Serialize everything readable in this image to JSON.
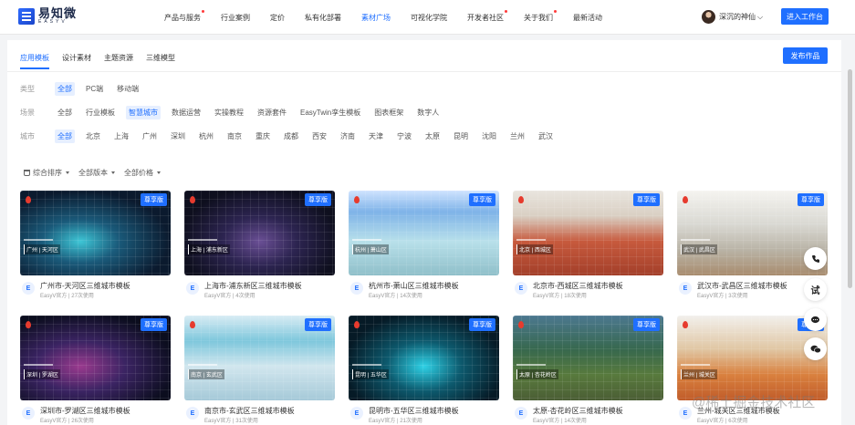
{
  "header": {
    "logo_cn": "易知微",
    "logo_en": "EASYV",
    "nav": [
      {
        "label": "产品与服务",
        "dot": true,
        "active": false
      },
      {
        "label": "行业案例",
        "dot": false,
        "active": false
      },
      {
        "label": "定价",
        "dot": false,
        "active": false
      },
      {
        "label": "私有化部署",
        "dot": false,
        "active": false
      },
      {
        "label": "素材广场",
        "dot": false,
        "active": true
      },
      {
        "label": "可视化学院",
        "dot": false,
        "active": false
      },
      {
        "label": "开发者社区",
        "dot": true,
        "active": false
      },
      {
        "label": "关于我们",
        "dot": true,
        "active": false
      },
      {
        "label": "最新活动",
        "dot": false,
        "active": false
      }
    ],
    "username": "深沉的神仙",
    "workspace_button": "进入工作台"
  },
  "tabs": [
    {
      "label": "应用模板",
      "active": true
    },
    {
      "label": "设计素材",
      "active": false
    },
    {
      "label": "主题资源",
      "active": false
    },
    {
      "label": "三维模型",
      "active": false
    }
  ],
  "publish_button": "发布作品",
  "filters": [
    {
      "label": "类型",
      "options": [
        "全部",
        "PC端",
        "移动端"
      ],
      "active": 0
    },
    {
      "label": "场景",
      "options": [
        "全部",
        "行业模板",
        "智慧城市",
        "数据运营",
        "实操教程",
        "资源套件",
        "EasyTwin孪生模板",
        "图表框架",
        "数字人"
      ],
      "active": 2
    },
    {
      "label": "城市",
      "options": [
        "全部",
        "北京",
        "上海",
        "广州",
        "深圳",
        "杭州",
        "南京",
        "重庆",
        "成都",
        "西安",
        "济南",
        "天津",
        "宁波",
        "太原",
        "昆明",
        "沈阳",
        "兰州",
        "武汉"
      ],
      "active": 0
    }
  ],
  "sorts": [
    "综合排序",
    "全部版本",
    "全部价格"
  ],
  "cards": [
    {
      "title": "广州市-天河区三维城市模板",
      "author": "EasyV官方",
      "usage": "27次使用",
      "badge": "尊享版",
      "loc": "广州 | 天河区"
    },
    {
      "title": "上海市-浦东新区三维城市模板",
      "author": "EasyV官方",
      "usage": "4次使用",
      "badge": "尊享版",
      "loc": "上海 | 浦东新区"
    },
    {
      "title": "杭州市-萧山区三维城市模板",
      "author": "EasyV官方",
      "usage": "14次使用",
      "badge": "尊享版",
      "loc": "杭州 | 萧山区"
    },
    {
      "title": "北京市-西城区三维城市模板",
      "author": "EasyV官方",
      "usage": "18次使用",
      "badge": "尊享版",
      "loc": "北京 | 西城区"
    },
    {
      "title": "武汉市-武昌区三维城市模板",
      "author": "EasyV官方",
      "usage": "3次使用",
      "badge": "尊享版",
      "loc": "武汉 | 武昌区"
    },
    {
      "title": "深圳市-罗湖区三维城市模板",
      "author": "EasyV官方",
      "usage": "26次使用",
      "badge": "尊享版",
      "loc": "深圳 | 罗湖区"
    },
    {
      "title": "南京市-玄武区三维城市模板",
      "author": "EasyV官方",
      "usage": "31次使用",
      "badge": "尊享版",
      "loc": "南京 | 玄武区"
    },
    {
      "title": "昆明市-五华区三维城市模板",
      "author": "EasyV官方",
      "usage": "21次使用",
      "badge": "尊享版",
      "loc": "昆明 | 五华区"
    },
    {
      "title": "太原-杏花岭区三维城市模板",
      "author": "EasyV官方",
      "usage": "14次使用",
      "badge": "尊享版",
      "loc": "太原 | 杏花岭区"
    },
    {
      "title": "兰州-城关区三维城市模板",
      "author": "EasyV官方",
      "usage": "6次使用",
      "badge": "尊享版",
      "loc": "兰州 | 城关区"
    }
  ],
  "side_buttons": [
    "phone-icon",
    "试",
    "chat-icon",
    "wechat-icon"
  ],
  "side_try_label": "试",
  "watermark": "@稀土掘金技术社区"
}
